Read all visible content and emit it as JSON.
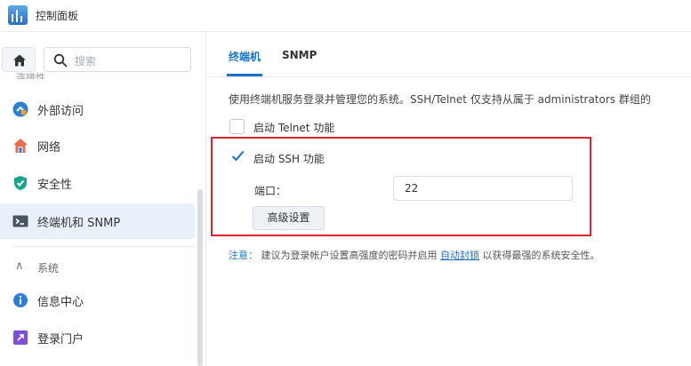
{
  "window": {
    "title": "控制面板",
    "icon": "control-panel-icon"
  },
  "sidebar": {
    "search_placeholder": "搜索",
    "cut_item_label": "连接性",
    "items": [
      {
        "label": "外部访问",
        "icon": "external-access-icon"
      },
      {
        "label": "网络",
        "icon": "network-icon"
      },
      {
        "label": "安全性",
        "icon": "security-shield-icon"
      },
      {
        "label": "终端机和 SNMP",
        "icon": "terminal-icon",
        "active": true
      }
    ],
    "section": {
      "label": "系统",
      "icon": "chevron-up-icon"
    },
    "system_items": [
      {
        "label": "信息中心",
        "icon": "info-center-icon"
      },
      {
        "label": "登录门户",
        "icon": "login-portal-icon"
      }
    ]
  },
  "main": {
    "tabs": [
      {
        "label": "终端机",
        "active": true
      },
      {
        "label": "SNMP",
        "active": false
      }
    ],
    "description": "使用终端机服务登录并管理您的系统。SSH/Telnet 仅支持从属于 administrators 群组的",
    "telnet": {
      "label": "启动 Telnet 功能",
      "checked": false
    },
    "ssh": {
      "label": "启动 SSH 功能",
      "checked": true
    },
    "port": {
      "label": "端口：",
      "value": "22"
    },
    "advanced_button": "高级设置",
    "note": {
      "heading": "注意：",
      "text": "建议为登录帐户设置高强度的密码并启用",
      "link": "自动封锁",
      "suffix": "以获得最强的系统安全性。"
    }
  },
  "colors": {
    "accent": "#1a73c8",
    "highlight_border": "#d9252e",
    "active_bg": "#e8f0fa"
  }
}
